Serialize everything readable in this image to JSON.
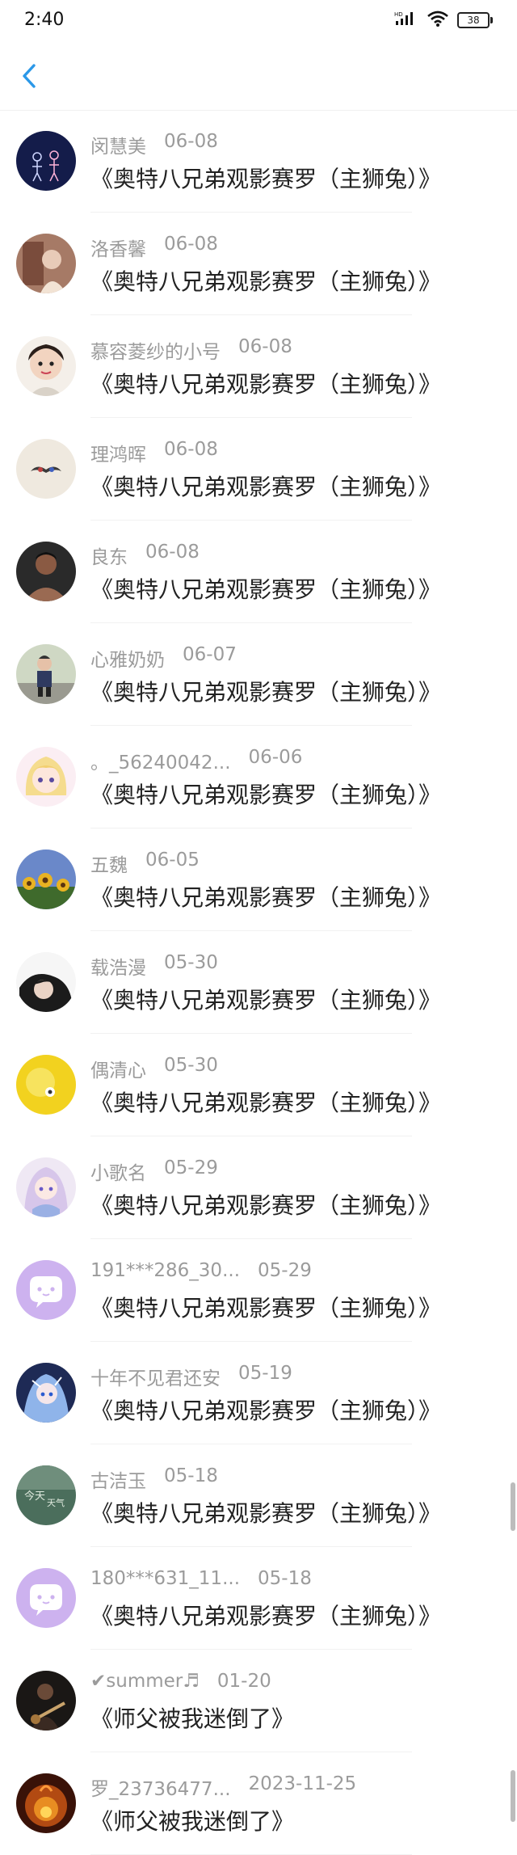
{
  "status": {
    "time": "2:40",
    "battery": "38",
    "network": "HD"
  },
  "nav": {
    "back_icon": "chevron-left-icon"
  },
  "colors": {
    "accent": "#2b98e8",
    "muted": "#9b9b9b",
    "text": "#222222"
  },
  "items": [
    {
      "name": "闵慧美",
      "date": "06-08",
      "title": "《奥特八兄弟观影赛罗（主狮兔）》",
      "avatar": "avatar-dark-figures"
    },
    {
      "name": "洛香馨",
      "date": "06-08",
      "title": "《奥特八兄弟观影赛罗（主狮兔）》",
      "avatar": "avatar-photo-brown"
    },
    {
      "name": "慕容菱纱的小号",
      "date": "06-08",
      "title": "《奥特八兄弟观影赛罗（主狮兔）》",
      "avatar": "avatar-child"
    },
    {
      "name": "理鸿晖",
      "date": "06-08",
      "title": "《奥特八兄弟观影赛罗（主狮兔）》",
      "avatar": "avatar-mustache"
    },
    {
      "name": "良东",
      "date": "06-08",
      "title": "《奥特八兄弟观影赛罗（主狮兔）》",
      "avatar": "avatar-man"
    },
    {
      "name": "心雅奶奶",
      "date": "06-07",
      "title": "《奥特八兄弟观影赛罗（主狮兔）》",
      "avatar": "avatar-kid-outdoor"
    },
    {
      "name": "。_56240042...",
      "date": "06-06",
      "title": "《奥特八兄弟观影赛罗（主狮兔）》",
      "avatar": "avatar-anime-blonde"
    },
    {
      "name": "五魏",
      "date": "06-05",
      "title": "《奥特八兄弟观影赛罗（主狮兔）》",
      "avatar": "avatar-sunflowers"
    },
    {
      "name": "载浩漫",
      "date": "05-30",
      "title": "《奥特八兄弟观影赛罗（主狮兔）》",
      "avatar": "avatar-face-dark-hair"
    },
    {
      "name": "偶清心",
      "date": "05-30",
      "title": "《奥特八兄弟观影赛罗（主狮兔）》",
      "avatar": "avatar-yellow-flower"
    },
    {
      "name": "小歌名",
      "date": "05-29",
      "title": "《奥特八兄弟观影赛罗（主狮兔）》",
      "avatar": "avatar-anime-purple"
    },
    {
      "name": "191***286_30...",
      "date": "05-29",
      "title": "《奥特八兄弟观影赛罗（主狮兔）》",
      "avatar": "avatar-default-chat"
    },
    {
      "name": "十年不见君还安",
      "date": "05-19",
      "title": "《奥特八兄弟观影赛罗（主狮兔）》",
      "avatar": "avatar-anime-blue"
    },
    {
      "name": "古洁玉",
      "date": "05-18",
      "title": "《奥特八兄弟观影赛罗（主狮兔）》",
      "avatar": "avatar-green-text"
    },
    {
      "name": "180***631_11...",
      "date": "05-18",
      "title": "《奥特八兄弟观影赛罗（主狮兔）》",
      "avatar": "avatar-default-chat"
    },
    {
      "name": "✔summer♬",
      "date": "01-20",
      "title": "《师父被我迷倒了》",
      "avatar": "avatar-guitar"
    },
    {
      "name": "罗_23736477...",
      "date": "2023-11-25",
      "title": "《师父被我迷倒了》",
      "avatar": "avatar-fire"
    }
  ]
}
